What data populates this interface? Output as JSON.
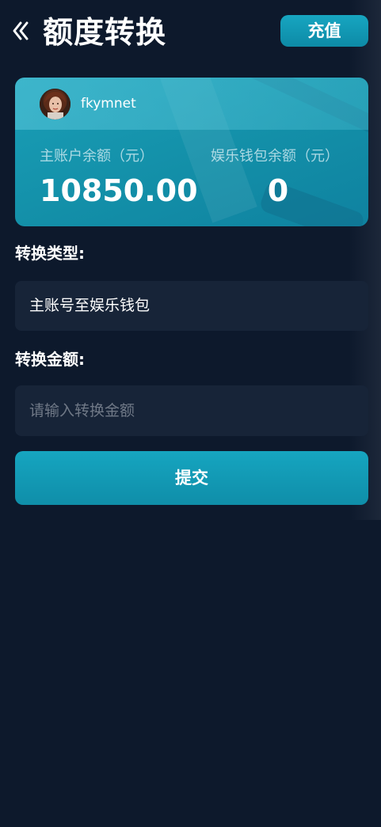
{
  "header": {
    "back_icon": "double-chevron-left-icon",
    "title": "额度转换",
    "recharge_label": "充值"
  },
  "card": {
    "avatar": "user-avatar",
    "username": "fkymnet",
    "main_account_label": "主账户余额（元）",
    "main_account_value": "10850.00",
    "wallet_label": "娱乐钱包余额（元）",
    "wallet_value": "0"
  },
  "form": {
    "type_label": "转换类型:",
    "type_value": "主账号至娱乐钱包",
    "amount_label": "转换金额:",
    "amount_placeholder": "请输入转换金额",
    "amount_value": "",
    "submit_label": "提交"
  },
  "colors": {
    "background": "#0d192c",
    "accent": "#139fb9",
    "field_bg": "#172438"
  }
}
